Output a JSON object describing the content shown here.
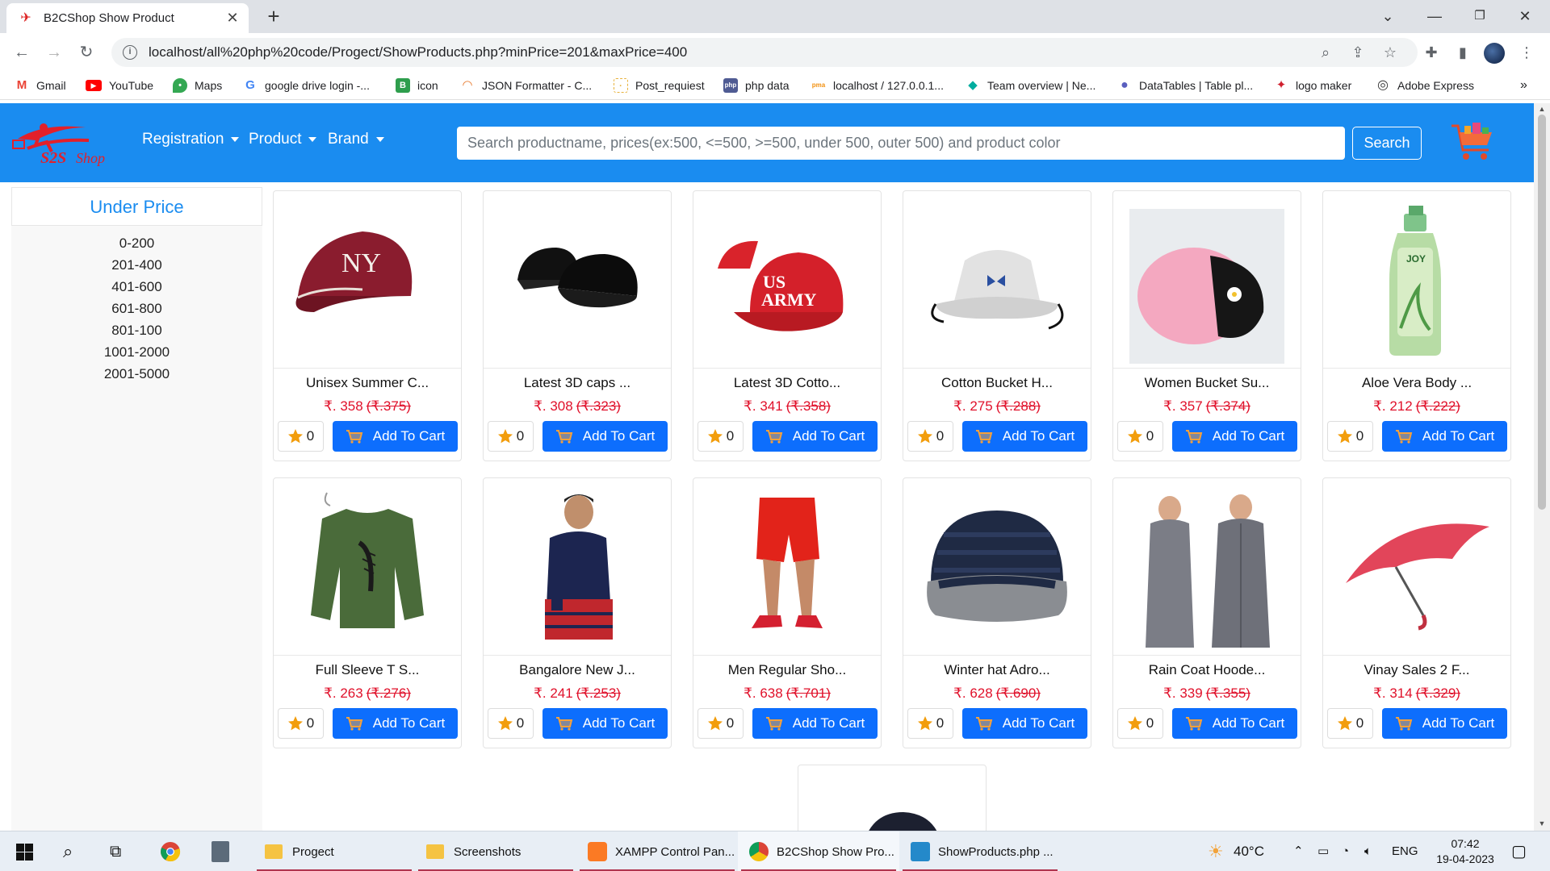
{
  "browser": {
    "tab_title": "B2CShop Show Product",
    "tab_close": "✕",
    "new_tab": "+",
    "url": "localhost/all%20php%20code/Progect/ShowProducts.php?minPrice=201&maxPrice=400",
    "bookmarks": [
      {
        "label": "Gmail",
        "icon": "gmail-icon",
        "color": "#ea4335",
        "glyph": "M"
      },
      {
        "label": "YouTube",
        "icon": "youtube-icon",
        "color": "#ff0000",
        "glyph": "▶"
      },
      {
        "label": "Maps",
        "icon": "maps-icon",
        "color": "#34a853",
        "glyph": "•"
      },
      {
        "label": "google drive login -...",
        "icon": "google-icon",
        "color": "#4285f4",
        "glyph": "G"
      },
      {
        "label": "icon",
        "icon": "icon-site-icon",
        "color": "#2e9e4d",
        "glyph": "B"
      },
      {
        "label": "JSON Formatter - C...",
        "icon": "json-formatter-icon",
        "color": "#e8792c",
        "glyph": "◠"
      },
      {
        "label": "Post_requiest",
        "icon": "post-request-icon",
        "color": "#e8b23c",
        "glyph": "·"
      },
      {
        "label": "php data",
        "icon": "php-icon",
        "color": "#4f5b93",
        "glyph": "php"
      },
      {
        "label": "localhost / 127.0.0.1...",
        "icon": "phpmyadmin-icon",
        "color": "#f29111",
        "glyph": "pma"
      },
      {
        "label": "Team overview | Ne...",
        "icon": "netlify-icon",
        "color": "#00ad9f",
        "glyph": "◆"
      },
      {
        "label": "DataTables | Table pl...",
        "icon": "datatables-icon",
        "color": "#5a5fbf",
        "glyph": "●"
      },
      {
        "label": "logo maker",
        "icon": "logo-maker-icon",
        "color": "#d0202e",
        "glyph": "✦"
      },
      {
        "label": "Adobe Express",
        "icon": "adobe-express-icon",
        "color": "#333333",
        "glyph": "◎"
      }
    ],
    "bookmarks_more": "»"
  },
  "site": {
    "brand_color": "#1a8cf0",
    "nav": [
      {
        "label": "Registration"
      },
      {
        "label": "Product"
      },
      {
        "label": "Brand"
      }
    ],
    "search_placeholder": "Search productname, prices(ex:500, <=500, >=500, under 500, outer 500) and product color",
    "search_button": "Search"
  },
  "sidebar": {
    "title": "Under Price",
    "ranges": [
      "0-200",
      "201-400",
      "401-600",
      "601-800",
      "801-100",
      "1001-2000",
      "2001-5000"
    ]
  },
  "products": [
    {
      "name": "Unisex Summer C...",
      "price": "₹. 358",
      "old_price": "(₹.375)",
      "rating": "0",
      "cart_label": "Add To Cart",
      "image": "maroon-cap"
    },
    {
      "name": "Latest 3D caps ...",
      "price": "₹. 308",
      "old_price": "(₹.323)",
      "rating": "0",
      "cart_label": "Add To Cart",
      "image": "black-caps"
    },
    {
      "name": "Latest 3D Cotto...",
      "price": "₹. 341",
      "old_price": "(₹.358)",
      "rating": "0",
      "cart_label": "Add To Cart",
      "image": "red-army-cap"
    },
    {
      "name": "Cotton Bucket H...",
      "price": "₹. 275",
      "old_price": "(₹.288)",
      "rating": "0",
      "cart_label": "Add To Cart",
      "image": "grey-bucket-hat"
    },
    {
      "name": "Women Bucket Su...",
      "price": "₹. 357",
      "old_price": "(₹.374)",
      "rating": "0",
      "cart_label": "Add To Cart",
      "image": "pink-bucket-hat"
    },
    {
      "name": "Aloe Vera Body ...",
      "price": "₹. 212",
      "old_price": "(₹.222)",
      "rating": "0",
      "cart_label": "Add To Cart",
      "image": "lotion-bottle"
    },
    {
      "name": "Full Sleeve T S...",
      "price": "₹. 263",
      "old_price": "(₹.276)",
      "rating": "0",
      "cart_label": "Add To Cart",
      "image": "green-sweatshirt"
    },
    {
      "name": "Bangalore New J...",
      "price": "₹. 241",
      "old_price": "(₹.253)",
      "rating": "0",
      "cart_label": "Add To Cart",
      "image": "jersey-man"
    },
    {
      "name": "Men Regular Sho...",
      "price": "₹. 638",
      "old_price": "(₹.701)",
      "rating": "0",
      "cart_label": "Add To Cart",
      "image": "red-shorts"
    },
    {
      "name": "Winter hat Adro...",
      "price": "₹. 628",
      "old_price": "(₹.690)",
      "rating": "0",
      "cart_label": "Add To Cart",
      "image": "beanie"
    },
    {
      "name": "Rain Coat Hoode...",
      "price": "₹. 339",
      "old_price": "(₹.355)",
      "rating": "0",
      "cart_label": "Add To Cart",
      "image": "raincoats"
    },
    {
      "name": "Vinay Sales 2 F...",
      "price": "₹. 314",
      "old_price": "(₹.329)",
      "rating": "0",
      "cart_label": "Add To Cart",
      "image": "red-umbrella"
    }
  ],
  "taskbar": {
    "apps": [
      {
        "label": "Progect",
        "icon": "folder-icon"
      },
      {
        "label": "Screenshots",
        "icon": "folder-icon"
      },
      {
        "label": "XAMPP Control Pan...",
        "icon": "xampp-icon"
      },
      {
        "label": "B2CShop Show Pro...",
        "icon": "chrome-icon"
      },
      {
        "label": "ShowProducts.php ...",
        "icon": "vscode-icon"
      }
    ],
    "weather": "40°C",
    "language": "ENG",
    "time": "07:42",
    "date": "19-04-2023"
  }
}
